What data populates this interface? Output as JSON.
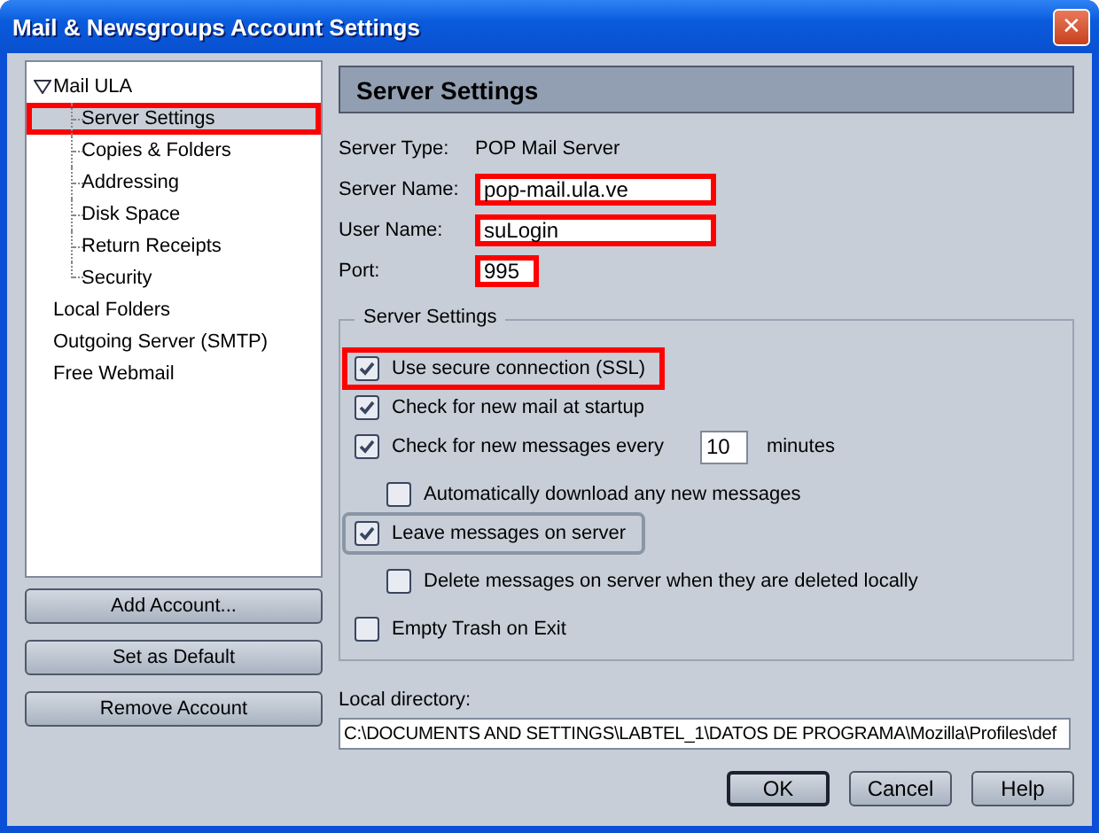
{
  "window": {
    "title": "Mail & Newsgroups Account Settings",
    "close": "✕"
  },
  "tree": [
    {
      "label": "Mail ULA",
      "expanded": true,
      "selected": false,
      "highlighted": false,
      "children": [
        {
          "label": "Server Settings",
          "selected": true,
          "highlighted": true
        },
        {
          "label": "Copies & Folders",
          "selected": false,
          "highlighted": false
        },
        {
          "label": "Addressing",
          "selected": false,
          "highlighted": false
        },
        {
          "label": "Disk Space",
          "selected": false,
          "highlighted": false
        },
        {
          "label": "Return Receipts",
          "selected": false,
          "highlighted": false
        },
        {
          "label": "Security",
          "selected": false,
          "highlighted": false
        }
      ]
    },
    {
      "label": "Local Folders",
      "selected": false,
      "highlighted": false
    },
    {
      "label": "Outgoing Server (SMTP)",
      "selected": false,
      "highlighted": false
    },
    {
      "label": "Free Webmail",
      "selected": false,
      "highlighted": false
    }
  ],
  "account_buttons": [
    "Add Account...",
    "Set as Default",
    "Remove Account"
  ],
  "panel": {
    "title": "Server Settings",
    "server_type": {
      "label": "Server Type:",
      "value": "POP Mail Server"
    },
    "fields": [
      {
        "label": "Server Name:",
        "value": "pop-mail.ula.ve",
        "kind": "wide",
        "highlighted": true
      },
      {
        "label": "User Name:",
        "value": "suLogin",
        "kind": "wide",
        "highlighted": true
      },
      {
        "label": "Port:",
        "value": "995",
        "kind": "short",
        "highlighted": true
      }
    ],
    "group": {
      "title": "Server Settings",
      "options": [
        {
          "kind": "checkbox",
          "label": "Use secure connection (SSL)",
          "checked": true,
          "highlighted": true,
          "focused": false
        },
        {
          "kind": "checkbox",
          "label": "Check for new mail at startup",
          "checked": true,
          "highlighted": false,
          "focused": false
        },
        {
          "kind": "interval",
          "label": "Check for new messages every",
          "value": "10",
          "suffix": "minutes",
          "checked": true,
          "highlighted": false,
          "focused": false,
          "children": [
            {
              "kind": "checkbox",
              "label": "Automatically download any new messages",
              "checked": false,
              "highlighted": false,
              "focused": false
            }
          ]
        },
        {
          "kind": "checkbox",
          "label": "Leave messages on server",
          "checked": true,
          "highlighted": false,
          "focused": true,
          "children": [
            {
              "kind": "checkbox",
              "label": "Delete messages on server when they are deleted locally",
              "checked": false,
              "highlighted": false,
              "focused": false
            }
          ]
        },
        {
          "kind": "checkbox",
          "label": "Empty Trash on Exit",
          "checked": false,
          "highlighted": false,
          "focused": false
        }
      ]
    },
    "local_directory": {
      "label": "Local directory:",
      "value": "C:\\DOCUMENTS AND SETTINGS\\LABTEL_1\\DATOS DE PROGRAMA\\Mozilla\\Profiles\\def"
    }
  },
  "dialog_buttons": [
    {
      "label": "OK",
      "default": true
    },
    {
      "label": "Cancel",
      "default": false
    },
    {
      "label": "Help",
      "default": false
    }
  ]
}
